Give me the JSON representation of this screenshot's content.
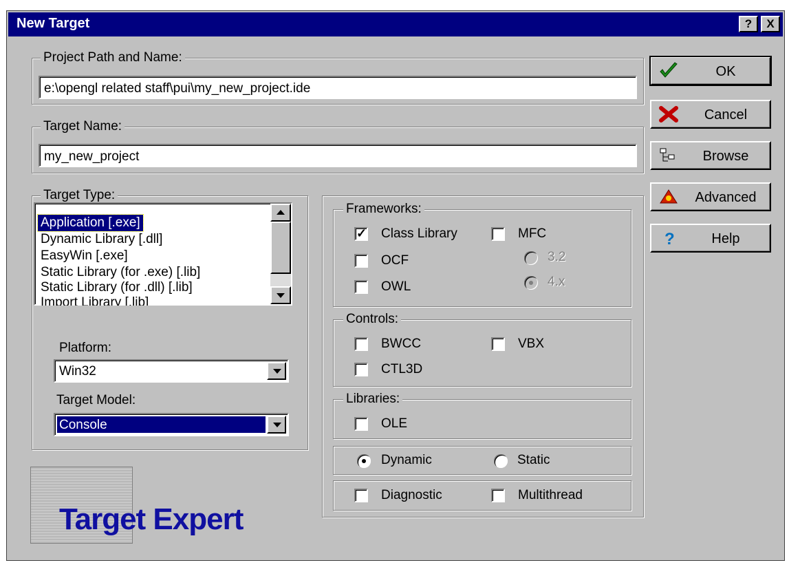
{
  "window": {
    "title": "New Target",
    "help_btn": "?",
    "close_btn": "X"
  },
  "project_path": {
    "label": "Project Path and Name:",
    "value": "e:\\opengl related staff\\pui\\my_new_project.ide"
  },
  "target_name": {
    "label": "Target Name:",
    "value": "my_new_project"
  },
  "target_type": {
    "label": "Target Type:",
    "items": [
      "Application [.exe]",
      "Dynamic Library [.dll]",
      "EasyWin [.exe]",
      "Static Library (for .exe) [.lib]",
      "Static Library (for .dll) [.lib]",
      "Import Library [.lib]"
    ],
    "selected": "Application [.exe]"
  },
  "platform": {
    "label": "Platform:",
    "value": "Win32"
  },
  "target_model": {
    "label": "Target Model:",
    "value": "Console"
  },
  "frameworks": {
    "label": "Frameworks:",
    "class_library": {
      "label": "Class Library",
      "checked": true
    },
    "mfc": {
      "label": "MFC",
      "checked": false
    },
    "ocf": {
      "label": "OCF",
      "checked": false
    },
    "owl": {
      "label": "OWL",
      "checked": false
    },
    "v32": {
      "label": "3.2",
      "selected": false,
      "enabled": false
    },
    "v4x": {
      "label": "4.x",
      "selected": true,
      "enabled": false
    }
  },
  "controls": {
    "label": "Controls:",
    "bwcc": {
      "label": "BWCC",
      "checked": false
    },
    "vbx": {
      "label": "VBX",
      "checked": false
    },
    "ctl3d": {
      "label": "CTL3D",
      "checked": false
    }
  },
  "libraries": {
    "label": "Libraries:",
    "ole": {
      "label": "OLE",
      "checked": false
    }
  },
  "linking": {
    "dynamic": {
      "label": "Dynamic",
      "selected": true
    },
    "static": {
      "label": "Static",
      "selected": false
    }
  },
  "options": {
    "diagnostic": {
      "label": "Diagnostic",
      "checked": false
    },
    "multithread": {
      "label": "Multithread",
      "checked": false
    }
  },
  "buttons": {
    "ok": "OK",
    "cancel": "Cancel",
    "browse": "Browse",
    "advanced": "Advanced",
    "help": "Help"
  },
  "logo": {
    "text": "Target Expert"
  },
  "icons": {
    "ok": "checkmark-icon",
    "cancel": "x-icon",
    "browse": "tree-icon",
    "advanced": "advanced-icon",
    "help": "question-icon"
  },
  "colors": {
    "face": "#c0c0c0",
    "titlebar": "#000080",
    "selection": "#000080",
    "logo_text": "#1010a0"
  }
}
